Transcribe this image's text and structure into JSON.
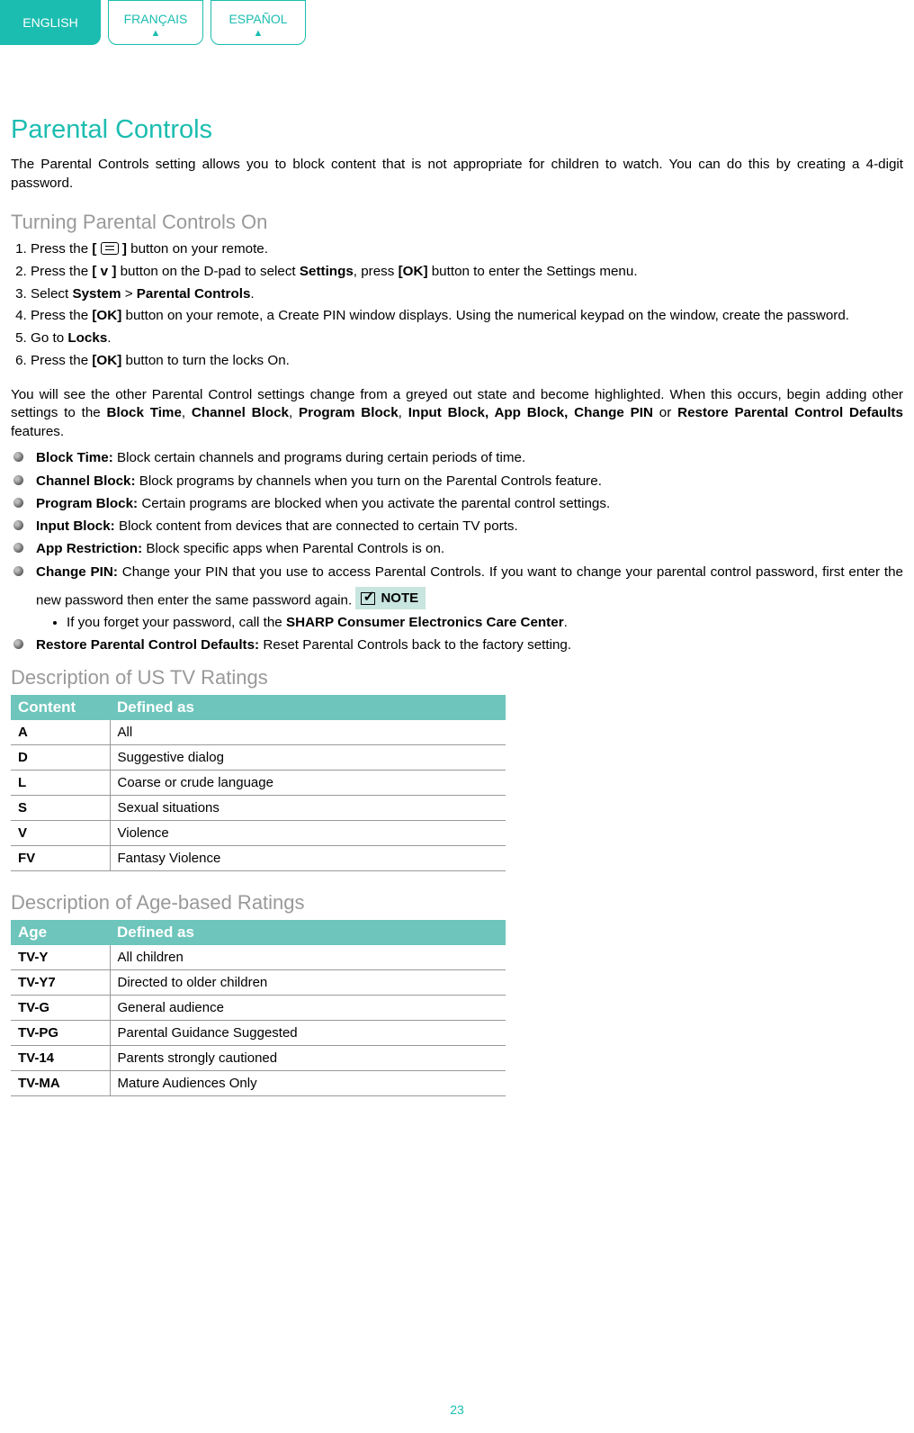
{
  "lang_tabs": [
    {
      "label": "ENGLISH",
      "active": true
    },
    {
      "label": "FRANÇAIS",
      "active": false
    },
    {
      "label": "ESPAÑOL",
      "active": false
    }
  ],
  "title": "Parental Controls",
  "intro": "The Parental Controls setting allows you to block content that is not appropriate for children to watch. You can do this by creating a 4-digit password.",
  "section_turn_on": "Turning Parental Controls On",
  "steps": {
    "s1a": "Press the ",
    "s1b": "[ ",
    "s1c": " ]",
    "s1d": " button on your remote.",
    "s2a": "Press the ",
    "s2b": "[ v ]",
    "s2c": " button on the D-pad to select ",
    "s2d": "Settings",
    "s2e": ", press ",
    "s2f": "[OK]",
    "s2g": " button to enter the Settings menu.",
    "s3a": "Select ",
    "s3b": "System",
    "s3c": " > ",
    "s3d": "Parental Controls",
    "s3e": ".",
    "s4a": "Press the ",
    "s4b": "[OK]",
    "s4c": " button on your remote, a Create PIN window displays. Using the numerical keypad on the window, create the password.",
    "s5a": "Go to ",
    "s5b": "Locks",
    "s5c": ".",
    "s6a": "Press the ",
    "s6b": "[OK]",
    "s6c": " button to turn the locks On."
  },
  "after_steps_a": "You will see the other Parental Control settings change from a greyed out state and become highlighted. When this occurs, begin adding other settings to the ",
  "after_steps_b": "Block Time",
  "after_steps_c": ", ",
  "after_steps_d": "Channel Block",
  "after_steps_e": ", ",
  "after_steps_f": "Program Block",
  "after_steps_g": ", ",
  "after_steps_h": "Input Block, App Block, Change PIN",
  "after_steps_i": " or ",
  "after_steps_j": "Restore Parental Control Defaults",
  "after_steps_k": " features.",
  "bullets": {
    "b1t": "Block Time:",
    "b1d": " Block certain channels and programs during certain periods of time.",
    "b2t": "Channel Block:",
    "b2d": " Block programs by channels when you turn on the Parental Controls feature.",
    "b3t": "Program Block:",
    "b3d": " Certain programs are blocked when you activate the parental control settings.",
    "b4t": "Input Block:",
    "b4d": " Block content from devices that are connected to certain TV ports.",
    "b5t": "App Restriction:",
    "b5d": " Block specific apps when Parental Controls is on.",
    "b6t": "Change PIN:",
    "b6d": " Change your PIN that you use to access Parental Controls. If you want to change your parental control password, first enter the new password then enter the same password again.",
    "b7t": "Restore Parental Control Defaults:",
    "b7d": " Reset Parental Controls back to the factory setting."
  },
  "note_label": "NOTE",
  "note_item_a": "If you forget your password, call the ",
  "note_item_b": "SHARP Consumer Electronics Care Center",
  "note_item_c": ".",
  "table1_title": "Description of US TV Ratings",
  "table1_h1": "Content",
  "table1_h2": "Defined as",
  "table1_rows": [
    {
      "c1": "A",
      "c2": "All"
    },
    {
      "c1": "D",
      "c2": "Suggestive dialog"
    },
    {
      "c1": "L",
      "c2": "Coarse or crude language"
    },
    {
      "c1": "S",
      "c2": "Sexual situations"
    },
    {
      "c1": "V",
      "c2": "Violence"
    },
    {
      "c1": "FV",
      "c2": "Fantasy Violence"
    }
  ],
  "table2_title": "Description of Age-based Ratings",
  "table2_h1": "Age",
  "table2_h2": "Defined as",
  "table2_rows": [
    {
      "c1": "TV-Y",
      "c2": "All children"
    },
    {
      "c1": "TV-Y7",
      "c2": "Directed to older children"
    },
    {
      "c1": "TV-G",
      "c2": "General audience"
    },
    {
      "c1": "TV-PG",
      "c2": "Parental Guidance Suggested"
    },
    {
      "c1": "TV-14",
      "c2": "Parents strongly cautioned"
    },
    {
      "c1": "TV-MA",
      "c2": "Mature Audiences Only"
    }
  ],
  "page_number": "23"
}
